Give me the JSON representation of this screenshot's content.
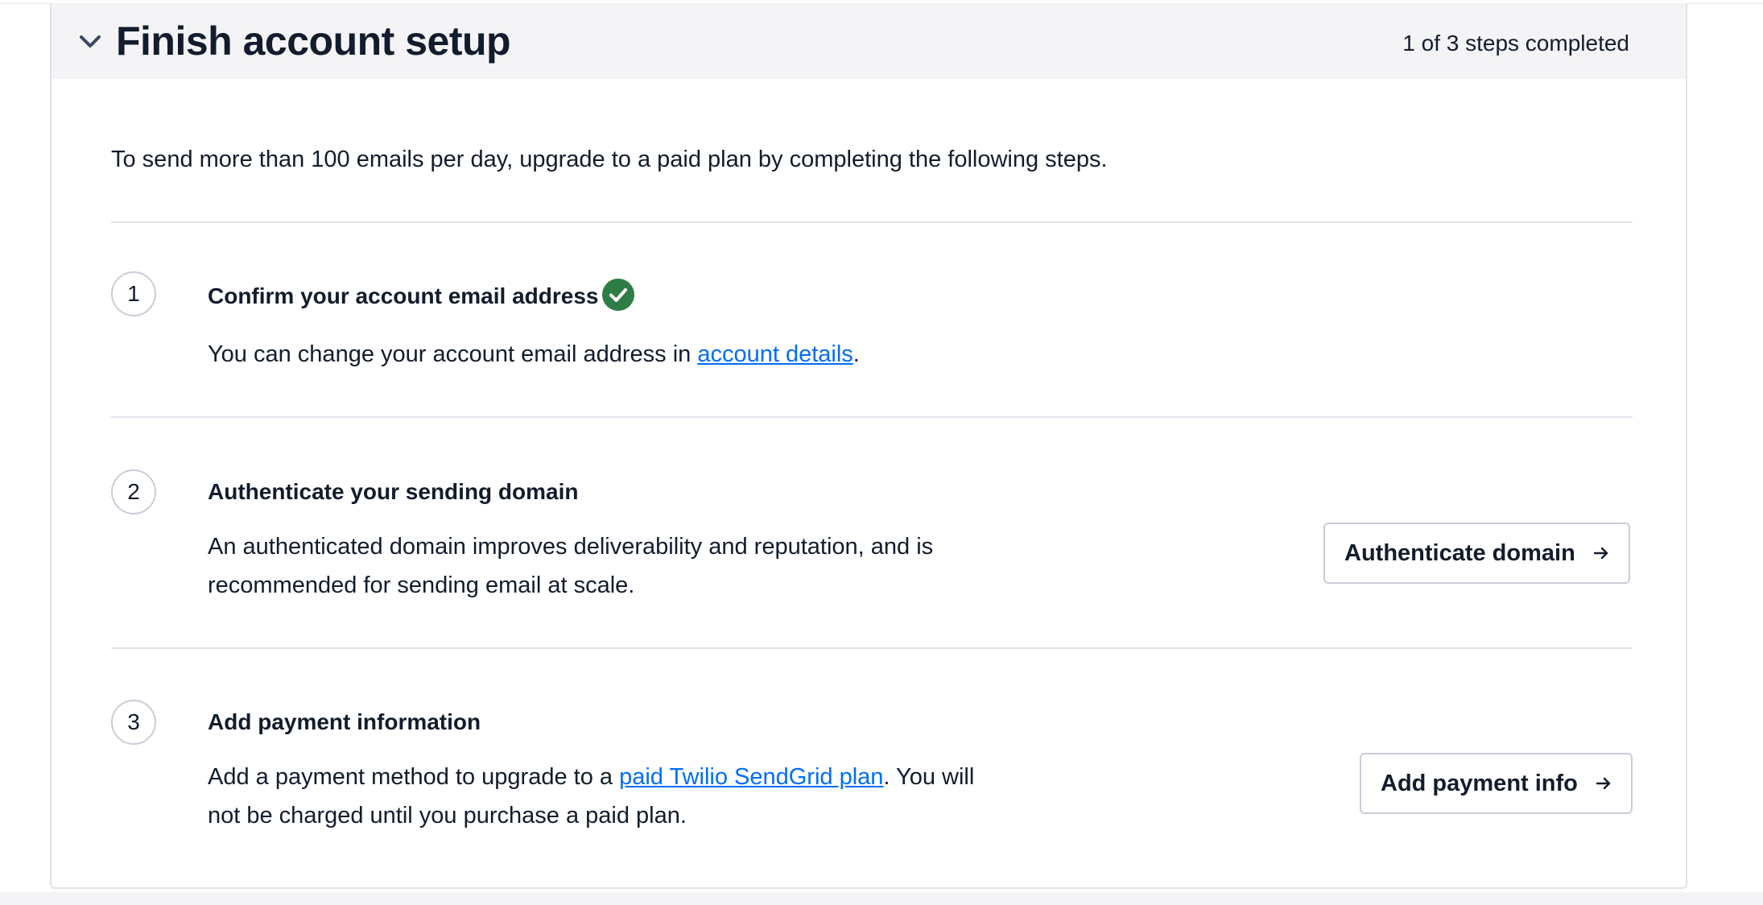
{
  "section": {
    "title": "Finish account setup",
    "progress": "1 of 3 steps completed",
    "intro": "To send more than 100 emails per day, upgrade to a paid plan by completing the following steps."
  },
  "steps": [
    {
      "number": "1",
      "title": "Confirm your account email address",
      "completed": true,
      "desc_before": "You can change your account email address in ",
      "link": "account details",
      "desc_after": "."
    },
    {
      "number": "2",
      "title": "Authenticate your sending domain",
      "completed": false,
      "desc": "An authenticated domain improves deliverability and reputation, and is recommended for sending email at scale.",
      "button": "Authenticate domain"
    },
    {
      "number": "3",
      "title": "Add payment information",
      "completed": false,
      "desc_before": "Add a payment method to upgrade to a ",
      "link": "paid Twilio SendGrid plan",
      "desc_after": ". You will not be charged until you purchase a paid plan.",
      "button": "Add payment info"
    }
  ],
  "icons": {
    "collapse": "chevron-down-icon",
    "completed": "check-circle-icon",
    "button_arrow": "arrow-right-icon"
  },
  "colors": {
    "success": "#2e7d47",
    "link": "#006dfa",
    "header_bg": "#f4f4f6",
    "text": "#121c2d"
  }
}
